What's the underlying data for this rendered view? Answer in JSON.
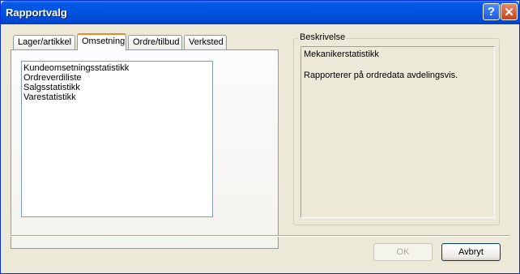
{
  "window": {
    "title": "Rapportvalg",
    "help_glyph": "?",
    "close_glyph": "✕"
  },
  "tabs": [
    {
      "label": "Lager/artikkel",
      "active": false
    },
    {
      "label": "Omsetning",
      "active": true
    },
    {
      "label": "Ordre/tilbud",
      "active": false
    },
    {
      "label": "Verksted",
      "active": false
    }
  ],
  "report_list": {
    "items": [
      "Kundeomsetningsstatistikk",
      "Ordreverdiliste",
      "Salgsstatistikk",
      "Varestatistikk"
    ]
  },
  "description": {
    "legend": "Beskrivelse",
    "title": "Mekanikerstatistikk",
    "text": "Rapporterer på ordredata avdelingsvis."
  },
  "buttons": {
    "ok": "OK",
    "cancel": "Avbryt"
  },
  "colors": {
    "title_bar": "#0054e3",
    "dialog_bg": "#ece9d8",
    "active_tab_accent": "#e68b2c"
  }
}
